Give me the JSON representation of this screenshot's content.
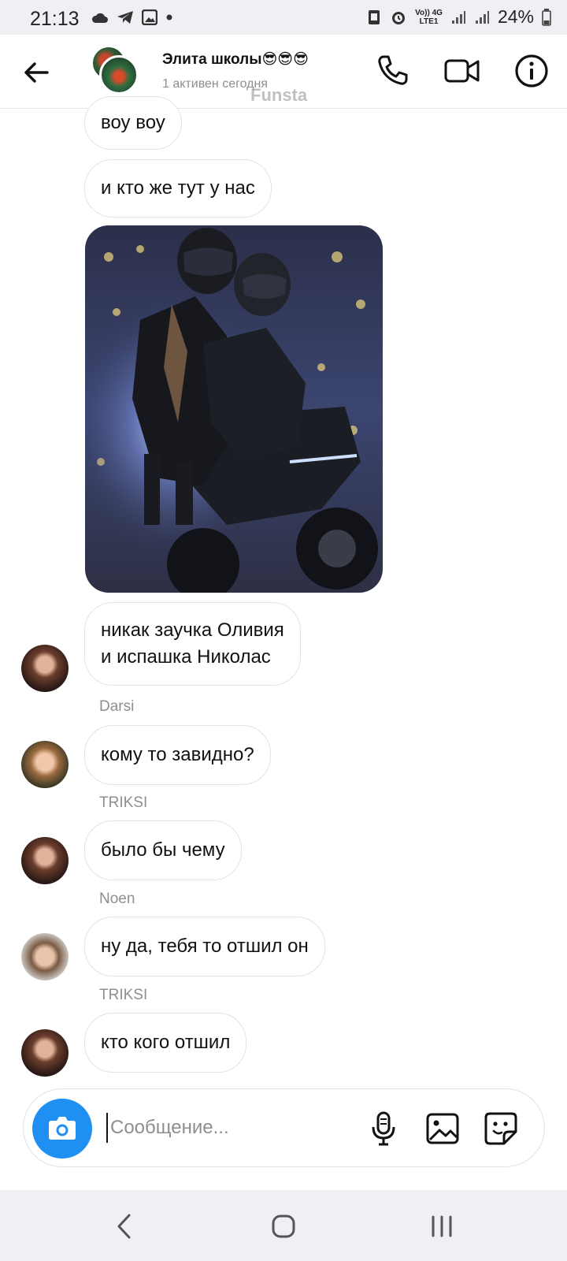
{
  "status_bar": {
    "time": "21:13",
    "net_top": "Vo)) 4G",
    "net_bottom": "LTE1",
    "battery": "24%"
  },
  "header": {
    "title": "Элита школы😎😎😎",
    "subtitle": "1 активен сегодня",
    "watermark": "Funsta"
  },
  "messages": [
    {
      "text": "воу воу"
    },
    {
      "text": "и кто же тут у нас"
    },
    {
      "text_line1": "никак заучка Оливия",
      "text_line2": "и испашка Николас",
      "sender": "Darsi"
    },
    {
      "text": "кому то завидно?",
      "sender": "TRIKSI"
    },
    {
      "text": "было бы чему",
      "sender": "Noen"
    },
    {
      "text": "ну да, тебя то отшил он",
      "sender": "TRIKSI"
    },
    {
      "text": "кто кого отшил"
    }
  ],
  "composer": {
    "placeholder": "Сообщение..."
  },
  "colors": {
    "accent": "#1f8ff2",
    "bubble_border": "#e3e3e3",
    "secondary_text": "#8e8e8e"
  }
}
